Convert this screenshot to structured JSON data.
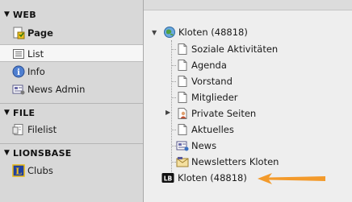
{
  "module_menu": {
    "groups": [
      {
        "title": "WEB",
        "items": [
          {
            "label": "Page",
            "icon": "page-module-icon",
            "active": false,
            "bold": true
          },
          {
            "label": "List",
            "icon": "list-module-icon",
            "active": true,
            "bold": false
          },
          {
            "label": "Info",
            "icon": "info-icon",
            "active": false,
            "bold": false
          },
          {
            "label": "News Admin",
            "icon": "news-admin-icon",
            "active": false,
            "bold": false
          }
        ]
      },
      {
        "title": "FILE",
        "items": [
          {
            "label": "Filelist",
            "icon": "filelist-icon",
            "active": false,
            "bold": false
          }
        ]
      },
      {
        "title": "LIONSBASE",
        "items": [
          {
            "label": "Clubs",
            "icon": "lionsbase-logo-icon",
            "active": false,
            "bold": false
          }
        ]
      }
    ]
  },
  "page_tree": {
    "root": {
      "label": "Kloten (48818)",
      "icon": "globe-site-icon",
      "expanded": true
    },
    "children": [
      {
        "label": "Soziale Aktivitäten",
        "icon": "page-icon"
      },
      {
        "label": "Agenda",
        "icon": "page-icon"
      },
      {
        "label": "Vorstand",
        "icon": "page-icon"
      },
      {
        "label": "Mitglieder",
        "icon": "page-icon"
      },
      {
        "label": "Private Seiten",
        "icon": "page-user-icon",
        "collapsed": true
      },
      {
        "label": "Aktuelles",
        "icon": "page-icon"
      },
      {
        "label": "News",
        "icon": "news-folder-icon"
      },
      {
        "label": "Newsletters Kloten",
        "icon": "newsletter-folder-icon"
      }
    ],
    "second_root": {
      "label": "Kloten (48818)",
      "icon": "lionsbase-record-icon"
    }
  },
  "colors": {
    "arrow": "#f39a2b",
    "menu_bg": "#d8d8d8",
    "tree_bg": "#eeeeee"
  }
}
